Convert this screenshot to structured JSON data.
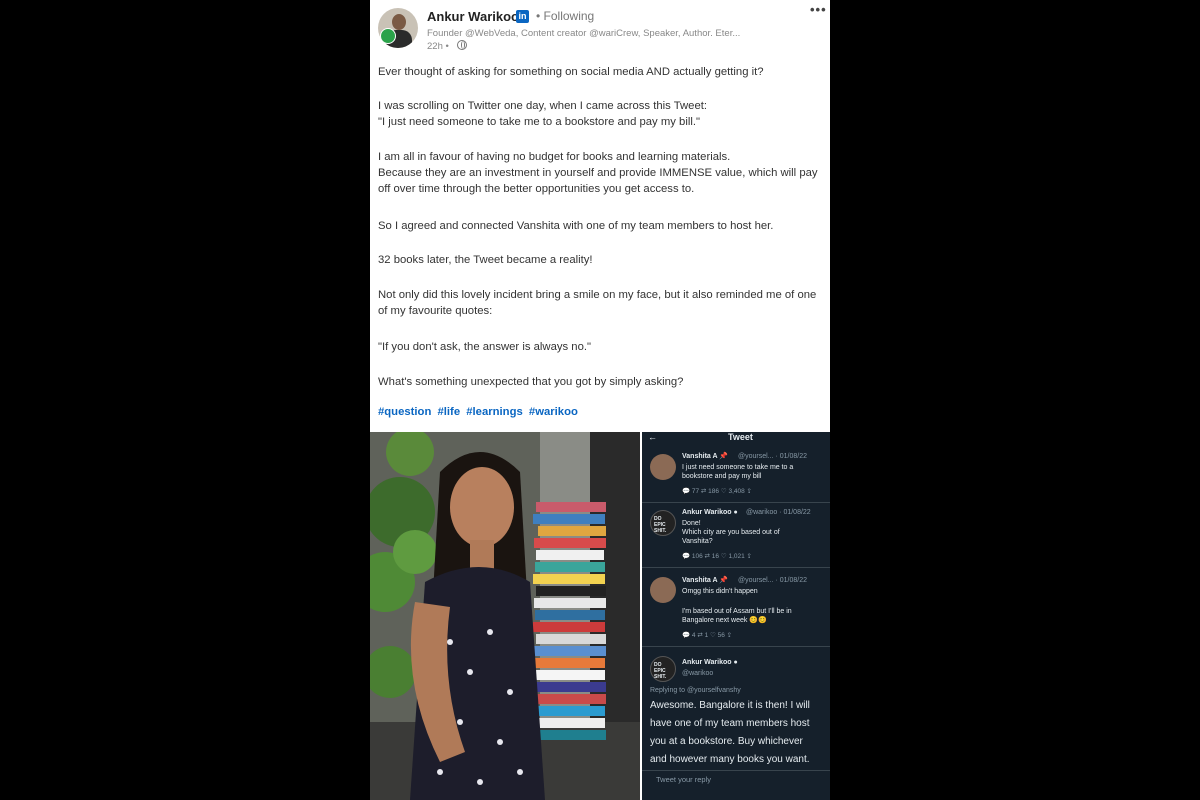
{
  "post": {
    "author": "Ankur Warikoo",
    "li_icon": "in",
    "following": "• Following",
    "headline": "Founder @WebVeda, Content creator @wariCrew, Speaker, Author. Eter...",
    "time": "22h •",
    "more": "•••",
    "paragraphs": [
      "Ever thought of asking for something on social media AND actually getting it?",
      "I was scrolling on Twitter one day, when I came across this Tweet:",
      "\"I just need someone to take me to a bookstore and pay my bill.\"",
      "I am all in favour of having no budget for books and learning materials.",
      "Because they are an investment in yourself and provide IMMENSE value, which will pay off over time through the better opportunities you get access to.",
      "So I agreed and connected Vanshita with one of my team members to host her.",
      "32 books later, the Tweet became a reality!",
      "Not only did this lovely incident bring a smile on my face, but it also reminded me of one of my favourite quotes:",
      "\"If you don't ask, the answer is always no.\"",
      "What's something unexpected that you got by simply asking?"
    ],
    "hashtags": [
      "#question",
      "#life",
      "#learnings",
      "#warikoo"
    ]
  },
  "tweet_screenshot": {
    "header": "Tweet",
    "back": "←",
    "t1": {
      "name": "Vanshita A 📌",
      "handle": "@yoursel... · 01/08/22",
      "text": [
        "I just need someone to take me to a",
        "bookstore and pay my bill"
      ],
      "stats": "💬 77    ⇄ 186    ♡ 3,408    ⇪"
    },
    "t2": {
      "name": "Ankur Warikoo ●",
      "handle": "@warikoo · 01/08/22",
      "text": [
        "Done!",
        "Which city are you based out of",
        "Vanshita?"
      ],
      "stats": "💬 106    ⇄ 16    ♡ 1,021    ⇪",
      "avatar_text": "DO EPIC SHIT."
    },
    "t3": {
      "name": "Vanshita A 📌",
      "handle": "@yoursel... · 01/08/22",
      "text": [
        "Omgg this didn't happen",
        "",
        "I'm based out of Assam but I'll be in",
        "Bangalore next week 😊😊"
      ],
      "stats": "💬 4    ⇄ 1    ♡ 56    ⇪"
    },
    "t4": {
      "name": "Ankur Warikoo ●",
      "handle": "@warikoo",
      "replying": "Replying to @yourselfvanshy",
      "text": [
        "Awesome. Bangalore it is then! I will",
        "have one of my team members host",
        "you at a bookstore. Buy whichever",
        "and however many books you want."
      ],
      "avatar_text": "DO EPIC SHIT."
    },
    "reply_placeholder": "Tweet your reply"
  },
  "colors": {
    "link": "#0a66c2",
    "twitter_bg": "#15202b",
    "page_bg": "#000000"
  }
}
